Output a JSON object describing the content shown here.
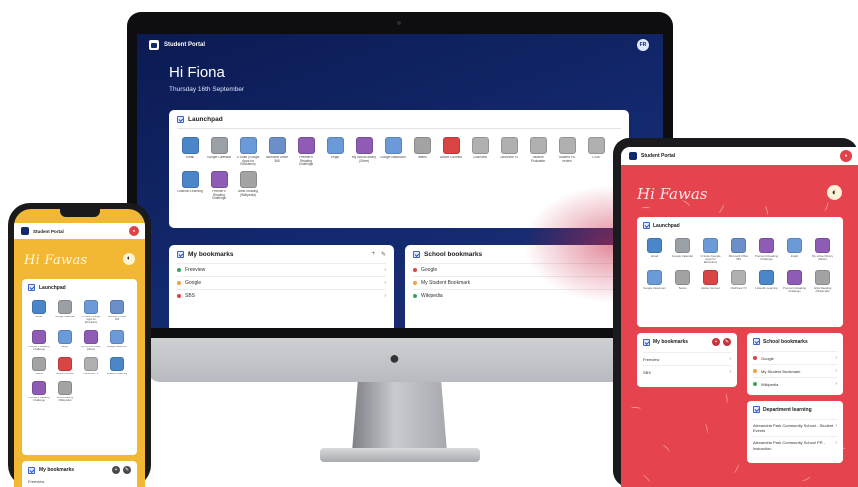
{
  "app": {
    "portal_title": "Student Portal"
  },
  "colors": {
    "desktop_bg": "#13296e",
    "phone_bg": "#f2b733",
    "tablet_bg": "#e5434d",
    "accent_blue": "#3c63d6"
  },
  "desktop": {
    "avatar_initials": "FR",
    "greeting": "Hi Fiona",
    "date": "Thursday 16th September",
    "launchpad_title": "Launchpad",
    "tiles": [
      {
        "label": "Email",
        "color": "#4a86c8",
        "icon": "email-icon"
      },
      {
        "label": "Google Calendar",
        "color": "#9aa0a6",
        "icon": "calendar-icon"
      },
      {
        "label": "G Suite (Google Apps for Education)",
        "color": "#6a9bd8",
        "icon": "gsuite-icon"
      },
      {
        "label": "Microsoft Office 365",
        "color": "#6c8fc9",
        "icon": "office-icon"
      },
      {
        "label": "Premier's Reading Challenge",
        "color": "#8e5bb5",
        "icon": "reading-icon"
      },
      {
        "label": "Englit",
        "color": "#6a9bd8",
        "icon": "englit-icon"
      },
      {
        "label": "My school library (Oliver)",
        "color": "#8e5bb5",
        "icon": "library-icon"
      },
      {
        "label": "Google classroom",
        "color": "#6a9bd8",
        "icon": "classroom-icon"
      },
      {
        "label": "Teams",
        "color": "#a3a3a3",
        "icon": "teams-icon"
      },
      {
        "label": "Adobe Connect",
        "color": "#d94545",
        "icon": "adobe-icon"
      },
      {
        "label": "ClickView",
        "color": "#b0b0b0",
        "icon": "clickview-icon"
      },
      {
        "label": "ClickView TV",
        "color": "#b0b0b0",
        "icon": "clickview-tv-icon"
      },
      {
        "label": "Student Podcaster",
        "color": "#b0b0b0",
        "icon": "podcast-icon"
      },
      {
        "label": "Student PD review",
        "color": "#b0b0b0",
        "icon": "review-icon"
      },
      {
        "label": "CSIS",
        "color": "#b0b0b0",
        "icon": "csis-icon"
      },
      {
        "label": "LinkedIn Learning",
        "color": "#4a86c8",
        "icon": "linkedin-icon"
      },
      {
        "label": "Premier's Reading Challenge",
        "color": "#8e5bb5",
        "icon": "reading-icon"
      },
      {
        "label": "Artist Reading (Wikipedia)",
        "color": "#a3a3a3",
        "icon": "artist-icon"
      }
    ],
    "my_bookmarks_title": "My bookmarks",
    "my_bookmarks": [
      {
        "label": "Freeview",
        "color": "#3aa357"
      },
      {
        "label": "Google",
        "color": "#f0a13a"
      },
      {
        "label": "SBS",
        "color": "#d94545"
      }
    ],
    "school_bookmarks_title": "School bookmarks",
    "school_bookmarks": [
      {
        "label": "Google",
        "color": "#d94545"
      },
      {
        "label": "My Student Bookmark",
        "color": "#f0a13a"
      },
      {
        "label": "Wikipedia",
        "color": "#3aa357"
      }
    ],
    "add_symbol": "+",
    "edit_symbol": "✎"
  },
  "phone": {
    "greeting": "Hi Fawas",
    "launchpad_title": "Launchpad",
    "tiles": [
      {
        "label": "Email",
        "color": "#4a86c8",
        "icon": "email-icon"
      },
      {
        "label": "Google Calendar",
        "color": "#9aa0a6",
        "icon": "calendar-icon"
      },
      {
        "label": "G Suite (Google Apps for Education)",
        "color": "#6a9bd8",
        "icon": "gsuite-icon"
      },
      {
        "label": "Microsoft Office 365",
        "color": "#6c8fc9",
        "icon": "office-icon"
      },
      {
        "label": "Premier's Reading Challenge",
        "color": "#8e5bb5",
        "icon": "reading-icon"
      },
      {
        "label": "Englit",
        "color": "#6a9bd8",
        "icon": "englit-icon"
      },
      {
        "label": "My school library (Oliver)",
        "color": "#8e5bb5",
        "icon": "library-icon"
      },
      {
        "label": "Google classroom",
        "color": "#6a9bd8",
        "icon": "classroom-icon"
      },
      {
        "label": "Teams",
        "color": "#a3a3a3",
        "icon": "teams-icon"
      },
      {
        "label": "Adobe Connect",
        "color": "#d94545",
        "icon": "adobe-icon"
      },
      {
        "label": "ClickView TV",
        "color": "#b0b0b0",
        "icon": "clickview-tv-icon"
      },
      {
        "label": "LinkedIn Learning",
        "color": "#4a86c8",
        "icon": "linkedin-icon"
      },
      {
        "label": "Premier's Reading Challenge",
        "color": "#8e5bb5",
        "icon": "reading-icon"
      },
      {
        "label": "Artist Reading (Wikipedia)",
        "color": "#a3a3a3",
        "icon": "artist-icon"
      }
    ],
    "my_bookmarks_title": "My bookmarks",
    "first_bookmark": "Freeview"
  },
  "tablet": {
    "greeting": "Hi Fawas",
    "launchpad_title": "Launchpad",
    "tiles": [
      {
        "label": "Email",
        "color": "#4a86c8",
        "icon": "email-icon"
      },
      {
        "label": "Google Calendar",
        "color": "#9aa0a6",
        "icon": "calendar-icon"
      },
      {
        "label": "G Suite (Google Apps for Education)",
        "color": "#6a9bd8",
        "icon": "gsuite-icon"
      },
      {
        "label": "Microsoft Office 365",
        "color": "#6c8fc9",
        "icon": "office-icon"
      },
      {
        "label": "Premier's Reading Challenge",
        "color": "#8e5bb5",
        "icon": "reading-icon"
      },
      {
        "label": "Englit",
        "color": "#6a9bd8",
        "icon": "englit-icon"
      },
      {
        "label": "My school library (Oliver)",
        "color": "#8e5bb5",
        "icon": "library-icon"
      },
      {
        "label": "Google classroom",
        "color": "#6a9bd8",
        "icon": "classroom-icon"
      },
      {
        "label": "Teams",
        "color": "#a3a3a3",
        "icon": "teams-icon"
      },
      {
        "label": "Adobe Connect",
        "color": "#d94545",
        "icon": "adobe-icon"
      },
      {
        "label": "ClickView TV",
        "color": "#b0b0b0",
        "icon": "clickview-tv-icon"
      },
      {
        "label": "LinkedIn Learning",
        "color": "#4a86c8",
        "icon": "linkedin-icon"
      },
      {
        "label": "Premier's Reading Challenge",
        "color": "#8e5bb5",
        "icon": "reading-icon"
      },
      {
        "label": "Artist Reading (Wikipedia)",
        "color": "#a3a3a3",
        "icon": "artist-icon"
      }
    ],
    "my_bookmarks_title": "My bookmarks",
    "my_bookmarks": [
      {
        "label": "Freeview"
      },
      {
        "label": "SBS"
      }
    ],
    "school_bookmarks_title": "School bookmarks",
    "school_bookmarks": [
      {
        "label": "Google",
        "color": "#d94545"
      },
      {
        "label": "My Student Bookmark",
        "color": "#f0a13a"
      },
      {
        "label": "Wikipedia",
        "color": "#3aa357"
      }
    ],
    "department_title": "Department learning",
    "department_items": [
      {
        "label": "Alexandria Park Community School - Student Events"
      },
      {
        "label": "Alexandria Park Community School PR - Instruction"
      }
    ]
  }
}
